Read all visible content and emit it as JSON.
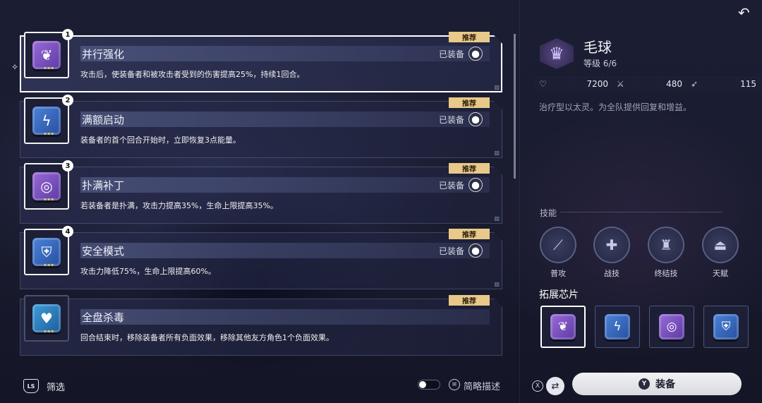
{
  "list": {
    "items": [
      {
        "num": "1",
        "title": "并行强化",
        "recommend": "推荐",
        "equipped": "已装备",
        "desc": "攻击后，使装备者和被攻击者受到的伤害提高25%，持续1回合。",
        "icon": "split-heart-icon",
        "color": "#8d5fd1"
      },
      {
        "num": "2",
        "title": "满额启动",
        "recommend": "推荐",
        "equipped": "已装备",
        "desc": "装备者的首个回合开始时，立即恢复3点能量。",
        "icon": "lightning-icon",
        "color": "#3f78cf"
      },
      {
        "num": "3",
        "title": "扑满补丁",
        "recommend": "推荐",
        "equipped": "已装备",
        "desc": "若装备者是扑满，攻击力提高35%，生命上限提高35%。",
        "icon": "spiral-icon",
        "color": "#8d5fd1"
      },
      {
        "num": "4",
        "title": "安全模式",
        "recommend": "推荐",
        "equipped": "已装备",
        "desc": "攻击力降低75%，生命上限提高60%。",
        "icon": "shield-icon",
        "color": "#3f78cf"
      },
      {
        "num": "",
        "title": "全盘杀毒",
        "recommend": "推荐",
        "equipped": "",
        "desc": "回合结束时，移除装备者所有负面效果，移除其他友方角色1个负面效果。",
        "icon": "heart-shield-icon",
        "color": "#2f8fd0"
      }
    ]
  },
  "bottom": {
    "ls_icon": "LS",
    "filter": "筛选",
    "menu_icon": "≡",
    "brief": "简略描述"
  },
  "character": {
    "name": "毛球",
    "level": "等级 6/6",
    "hp": "7200",
    "atk": "480",
    "spd": "115",
    "desc": "治疗型以太灵。为全队提供回复和增益。"
  },
  "skills": {
    "label": "技能",
    "items": [
      {
        "name": "普攻",
        "icon": "claw-icon"
      },
      {
        "name": "战技",
        "icon": "cross-icon"
      },
      {
        "name": "终结技",
        "icon": "crown-icon"
      },
      {
        "name": "天赋",
        "icon": "hand-icon"
      }
    ]
  },
  "expansion": {
    "label": "拓展芯片"
  },
  "actions": {
    "x_icon": "X",
    "y_icon": "Y",
    "equip": "装备"
  }
}
